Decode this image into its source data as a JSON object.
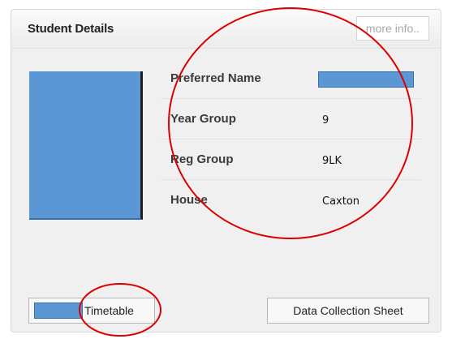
{
  "panel": {
    "title": "Student Details",
    "more_info_label": "more info.."
  },
  "details": {
    "rows": [
      {
        "label": "Preferred Name",
        "value": ""
      },
      {
        "label": "Year Group",
        "value": "9"
      },
      {
        "label": "Reg Group",
        "value": "9LK"
      },
      {
        "label": "House",
        "value": "Caxton"
      }
    ]
  },
  "buttons": {
    "timetable_label": "Timetable",
    "data_collection_label": "Data Collection Sheet"
  },
  "colors": {
    "redaction_blue": "#5b97d4",
    "annotation_red": "#dd0000"
  }
}
